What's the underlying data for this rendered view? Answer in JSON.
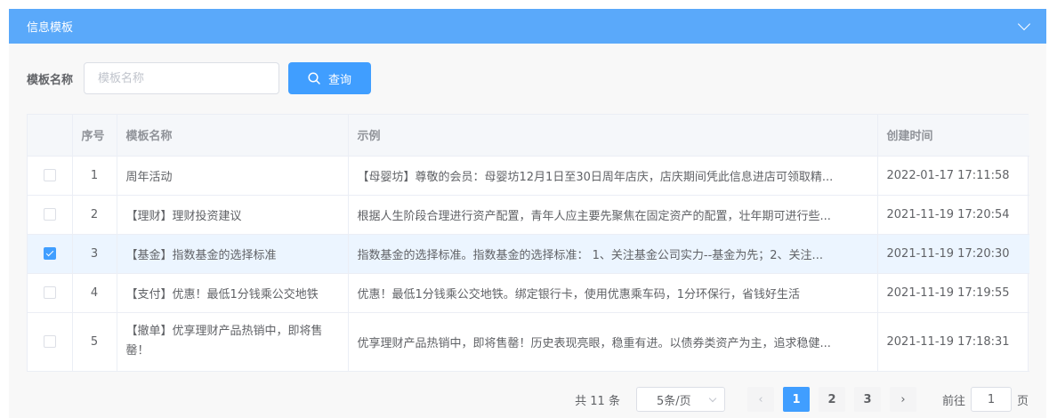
{
  "panel": {
    "title": "信息模板"
  },
  "search": {
    "label": "模板名称",
    "placeholder": "模板名称",
    "value": "",
    "button_label": "查询"
  },
  "table": {
    "columns": [
      "序号",
      "模板名称",
      "示例",
      "创建时间"
    ],
    "rows": [
      {
        "checked": false,
        "index": "1",
        "name": "周年活动",
        "example": "【母婴坊】尊敬的会员：母婴坊12月1日至30日周年店庆，店庆期间凭此信息进店可领取精...",
        "created": "2022-01-17 17:11:58"
      },
      {
        "checked": false,
        "index": "2",
        "name": "【理财】理财投资建议",
        "example": "根据人生阶段合理进行资产配置，青年人应主要先聚焦在固定资产的配置，壮年期可进行些...",
        "created": "2021-11-19 17:20:54"
      },
      {
        "checked": true,
        "index": "3",
        "name": "【基金】指数基金的选择标准",
        "example": "指数基金的选择标准。指数基金的选择标准： 1、关注基金公司实力--基金为先；2、关注...",
        "created": "2021-11-19 17:20:30"
      },
      {
        "checked": false,
        "index": "4",
        "name": "【支付】优惠！最低1分钱乘公交地铁",
        "example": "优惠！最低1分钱乘公交地铁。绑定银行卡，使用优惠乘车码，1分环保行，省钱好生活",
        "created": "2021-11-19 17:19:55"
      },
      {
        "checked": false,
        "index": "5",
        "name": "【撤单】优享理财产品热销中，即将售罄！",
        "example": "优享理财产品热销中，即将售罄！历史表现亮眼，稳重有进。以债券类资产为主，追求稳健...",
        "created": "2021-11-19 17:18:31"
      }
    ]
  },
  "pagination": {
    "total_label": "共 11 条",
    "page_size": "5条/页",
    "pages": [
      "1",
      "2",
      "3"
    ],
    "current_page": "1",
    "prev_icon": "‹",
    "next_icon": "›",
    "goto_prefix": "前往",
    "goto_value": "1",
    "goto_suffix": "页"
  },
  "colors": {
    "header": "#5aa9fa",
    "primary": "#409eff",
    "selected_row": "#ecf5ff"
  }
}
